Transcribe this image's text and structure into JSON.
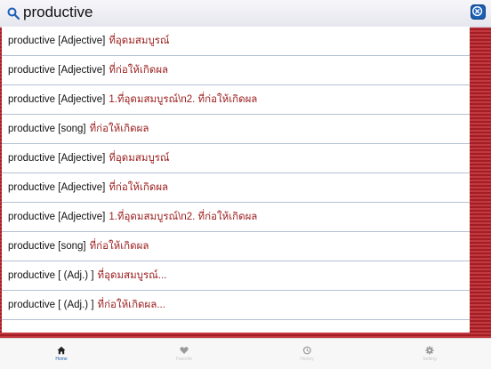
{
  "search": {
    "query": "productive"
  },
  "results": [
    {
      "word": "productive [Adjective]",
      "meaning": "ที่อุดมสมบูรณ์"
    },
    {
      "word": "productive [Adjective]",
      "meaning": "ที่ก่อให้เกิดผล"
    },
    {
      "word": "productive [Adjective]",
      "meaning": "1.ที่อุดมสมบูรณ์\\n2. ที่ก่อให้เกิดผล"
    },
    {
      "word": "productive [song]",
      "meaning": "ที่ก่อให้เกิดผล"
    },
    {
      "word": "productive [Adjective]",
      "meaning": "ที่อุดมสมบูรณ์"
    },
    {
      "word": "productive [Adjective]",
      "meaning": "ที่ก่อให้เกิดผล"
    },
    {
      "word": "productive [Adjective]",
      "meaning": "1.ที่อุดมสมบูรณ์\\n2. ที่ก่อให้เกิดผล"
    },
    {
      "word": "productive [song]",
      "meaning": "ที่ก่อให้เกิดผล"
    },
    {
      "word": "productive [ (Adj.) ]",
      "meaning": "ที่อุดมสมบูรณ์..."
    },
    {
      "word": "productive [ (Adj.) ]",
      "meaning": "ที่ก่อให้เกิดผล..."
    }
  ],
  "tabs": [
    {
      "label": "Home",
      "icon": "home-icon",
      "active": true
    },
    {
      "label": "Favorite",
      "icon": "heart-icon",
      "active": false
    },
    {
      "label": "History",
      "icon": "history-icon",
      "active": false
    },
    {
      "label": "Setting",
      "icon": "gear-icon",
      "active": false
    }
  ],
  "colors": {
    "accent": "#1a5fb4",
    "meaning": "#9b1c1c",
    "stripe": "#a31d24"
  }
}
